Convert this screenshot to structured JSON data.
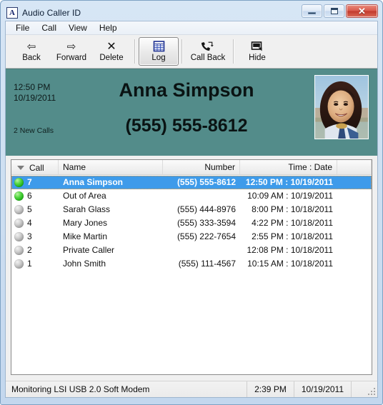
{
  "window": {
    "title": "Audio Caller ID",
    "icon": "app-icon-A",
    "icon_letter": "A",
    "minimize_label": "",
    "maximize_label": "",
    "close_label": "✕"
  },
  "menu": {
    "items": [
      {
        "label": "File"
      },
      {
        "label": "Call"
      },
      {
        "label": "View"
      },
      {
        "label": "Help"
      }
    ]
  },
  "toolbar": {
    "buttons": [
      {
        "label": "Back",
        "icon": "left-arrow-icon",
        "glyph": "⇦",
        "pressed": false
      },
      {
        "label": "Forward",
        "icon": "right-arrow-icon",
        "glyph": "⇨",
        "pressed": false
      },
      {
        "label": "Delete",
        "icon": "x-delete-icon",
        "glyph": "✕",
        "pressed": false
      },
      {
        "label": "Log",
        "icon": "grid-log-icon",
        "glyph": "",
        "pressed": true
      },
      {
        "label": "Call Back",
        "icon": "phone-callback-icon",
        "glyph": "",
        "pressed": false
      },
      {
        "label": "Hide",
        "icon": "monitor-hide-icon",
        "glyph": "",
        "pressed": false
      }
    ]
  },
  "banner": {
    "time": "12:50 PM",
    "date": "10/19/2011",
    "new_calls": "2 New Calls",
    "caller_name": "Anna Simpson",
    "caller_number": "(555) 555-8612",
    "photo_alt": "caller-photo",
    "background_color": "#538c8a"
  },
  "call_log": {
    "columns": [
      {
        "key": "call",
        "label": "Call",
        "sorted": true,
        "sort_direction": "descending"
      },
      {
        "key": "name",
        "label": "Name",
        "sorted": false
      },
      {
        "key": "number",
        "label": "Number",
        "sorted": false
      },
      {
        "key": "time",
        "label": "Time : Date",
        "sorted": false
      },
      {
        "key": "extra",
        "label": "",
        "sorted": false
      }
    ],
    "rows": [
      {
        "led": "new",
        "call": "7",
        "name": "Anna Simpson",
        "number": "(555) 555-8612",
        "time": "12:50 PM : 10/19/2011",
        "selected": true
      },
      {
        "led": "new",
        "call": "6",
        "name": "Out of Area",
        "number": "",
        "time": "10:09 AM : 10/19/2011",
        "selected": false
      },
      {
        "led": "old",
        "call": "5",
        "name": "Sarah Glass",
        "number": "(555) 444-8976",
        "time": "8:00 PM : 10/18/2011",
        "selected": false
      },
      {
        "led": "old",
        "call": "4",
        "name": "Mary Jones",
        "number": "(555) 333-3594",
        "time": "4:22 PM : 10/18/2011",
        "selected": false
      },
      {
        "led": "old",
        "call": "3",
        "name": "Mike Martin",
        "number": "(555) 222-7654",
        "time": "2:55 PM : 10/18/2011",
        "selected": false
      },
      {
        "led": "old",
        "call": "2",
        "name": "Private Caller",
        "number": "",
        "time": "12:08 PM : 10/18/2011",
        "selected": false
      },
      {
        "led": "old",
        "call": "1",
        "name": "John Smith",
        "number": "(555) 111-4567",
        "time": "10:15 AM : 10/18/2011",
        "selected": false
      }
    ]
  },
  "statusbar": {
    "message": "Monitoring LSI USB 2.0 Soft Modem",
    "time": "2:39 PM",
    "date": "10/19/2011"
  },
  "colors": {
    "banner": "#538c8a",
    "selection": "#3e9bea",
    "led_new": "#2ec21f",
    "led_old": "#9a9a9a",
    "close_button": "#c8392c"
  }
}
